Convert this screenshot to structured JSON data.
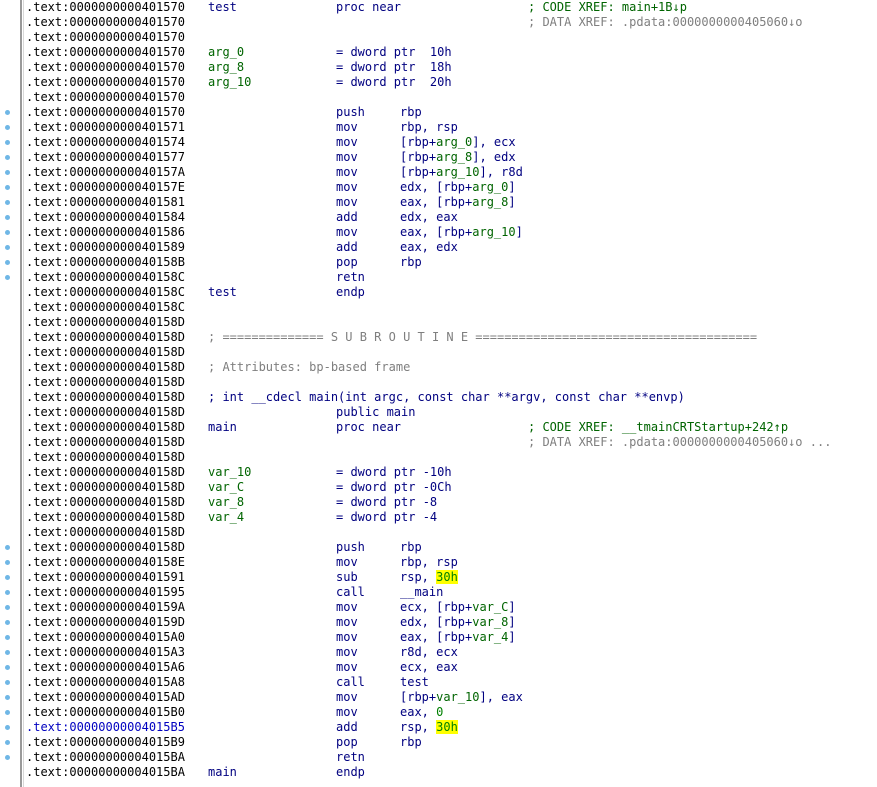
{
  "lines": [
    {
      "addr": ".text:0000000000401570",
      "parts": [
        [
          "label",
          "test",
          "c-blue"
        ],
        [
          "op",
          "proc near",
          "c-blue"
        ],
        [
          "comment",
          "; CODE XREF: main+1B↓p",
          "c-green"
        ]
      ]
    },
    {
      "addr": ".text:0000000000401570",
      "parts": [
        [
          "comment",
          "; DATA XREF: .pdata:0000000000405060↓o",
          "c-gray"
        ]
      ]
    },
    {
      "addr": ".text:0000000000401570",
      "parts": []
    },
    {
      "addr": ".text:0000000000401570",
      "parts": [
        [
          "label",
          "arg_0",
          "c-green"
        ],
        [
          "op",
          "= dword ptr  10h",
          "c-blue"
        ]
      ]
    },
    {
      "addr": ".text:0000000000401570",
      "parts": [
        [
          "label",
          "arg_8",
          "c-green"
        ],
        [
          "op",
          "= dword ptr  18h",
          "c-blue"
        ]
      ]
    },
    {
      "addr": ".text:0000000000401570",
      "parts": [
        [
          "label",
          "arg_10",
          "c-green"
        ],
        [
          "op",
          "= dword ptr  20h",
          "c-blue"
        ]
      ]
    },
    {
      "addr": ".text:0000000000401570",
      "parts": []
    },
    {
      "addr": ".text:0000000000401570",
      "dot": true,
      "parts": [
        [
          "op",
          "push",
          "c-blue"
        ],
        [
          "arg",
          "rbp",
          "c-blue"
        ]
      ]
    },
    {
      "addr": ".text:0000000000401571",
      "dot": true,
      "parts": [
        [
          "op",
          "mov",
          "c-blue"
        ],
        [
          "arg",
          "rbp, rsp",
          "c-blue"
        ]
      ]
    },
    {
      "addr": ".text:0000000000401574",
      "dot": true,
      "parts": [
        [
          "op",
          "mov",
          "c-blue"
        ],
        [
          "argrich",
          [
            [
              "[rbp+",
              "c-blue"
            ],
            [
              "arg_0",
              "c-green"
            ],
            [
              "], ecx",
              "c-blue"
            ]
          ]
        ]
      ]
    },
    {
      "addr": ".text:0000000000401577",
      "dot": true,
      "parts": [
        [
          "op",
          "mov",
          "c-blue"
        ],
        [
          "argrich",
          [
            [
              "[rbp+",
              "c-blue"
            ],
            [
              "arg_8",
              "c-green"
            ],
            [
              "], edx",
              "c-blue"
            ]
          ]
        ]
      ]
    },
    {
      "addr": ".text:000000000040157A",
      "dot": true,
      "parts": [
        [
          "op",
          "mov",
          "c-blue"
        ],
        [
          "argrich",
          [
            [
              "[rbp+",
              "c-blue"
            ],
            [
              "arg_10",
              "c-green"
            ],
            [
              "], r8d",
              "c-blue"
            ]
          ]
        ]
      ]
    },
    {
      "addr": ".text:000000000040157E",
      "dot": true,
      "parts": [
        [
          "op",
          "mov",
          "c-blue"
        ],
        [
          "argrich",
          [
            [
              "edx, [rbp+",
              "c-blue"
            ],
            [
              "arg_0",
              "c-green"
            ],
            [
              "]",
              "c-blue"
            ]
          ]
        ]
      ]
    },
    {
      "addr": ".text:0000000000401581",
      "dot": true,
      "parts": [
        [
          "op",
          "mov",
          "c-blue"
        ],
        [
          "argrich",
          [
            [
              "eax, [rbp+",
              "c-blue"
            ],
            [
              "arg_8",
              "c-green"
            ],
            [
              "]",
              "c-blue"
            ]
          ]
        ]
      ]
    },
    {
      "addr": ".text:0000000000401584",
      "dot": true,
      "parts": [
        [
          "op",
          "add",
          "c-blue"
        ],
        [
          "arg",
          "edx, eax",
          "c-blue"
        ]
      ]
    },
    {
      "addr": ".text:0000000000401586",
      "dot": true,
      "parts": [
        [
          "op",
          "mov",
          "c-blue"
        ],
        [
          "argrich",
          [
            [
              "eax, [rbp+",
              "c-blue"
            ],
            [
              "arg_10",
              "c-green"
            ],
            [
              "]",
              "c-blue"
            ]
          ]
        ]
      ]
    },
    {
      "addr": ".text:0000000000401589",
      "dot": true,
      "parts": [
        [
          "op",
          "add",
          "c-blue"
        ],
        [
          "arg",
          "eax, edx",
          "c-blue"
        ]
      ]
    },
    {
      "addr": ".text:000000000040158B",
      "dot": true,
      "parts": [
        [
          "op",
          "pop",
          "c-blue"
        ],
        [
          "arg",
          "rbp",
          "c-blue"
        ]
      ]
    },
    {
      "addr": ".text:000000000040158C",
      "dot": true,
      "parts": [
        [
          "op",
          "retn",
          "c-blue"
        ]
      ]
    },
    {
      "addr": ".text:000000000040158C",
      "parts": [
        [
          "label",
          "test",
          "c-blue"
        ],
        [
          "op",
          "endp",
          "c-blue"
        ]
      ]
    },
    {
      "addr": ".text:000000000040158C",
      "parts": []
    },
    {
      "addr": ".text:000000000040158D",
      "parts": []
    },
    {
      "addr": ".text:000000000040158D",
      "parts": [
        [
          "full",
          "; ============== S U B R O U T I N E =======================================",
          "c-gray"
        ]
      ]
    },
    {
      "addr": ".text:000000000040158D",
      "parts": []
    },
    {
      "addr": ".text:000000000040158D",
      "parts": [
        [
          "full",
          "; Attributes: bp-based frame",
          "c-gray"
        ]
      ]
    },
    {
      "addr": ".text:000000000040158D",
      "parts": []
    },
    {
      "addr": ".text:000000000040158D",
      "parts": [
        [
          "full",
          "; int __cdecl main(int argc, const char **argv, const char **envp)",
          "c-blue"
        ]
      ]
    },
    {
      "addr": ".text:000000000040158D",
      "parts": [
        [
          "op",
          "public main",
          "c-blue"
        ]
      ]
    },
    {
      "addr": ".text:000000000040158D",
      "parts": [
        [
          "label",
          "main",
          "c-blue"
        ],
        [
          "op",
          "proc near",
          "c-blue"
        ],
        [
          "comment",
          "; CODE XREF: __tmainCRTStartup+242↑p",
          "c-green"
        ]
      ]
    },
    {
      "addr": ".text:000000000040158D",
      "parts": [
        [
          "comment",
          "; DATA XREF: .pdata:0000000000405060↓o ...",
          "c-gray"
        ]
      ]
    },
    {
      "addr": ".text:000000000040158D",
      "parts": []
    },
    {
      "addr": ".text:000000000040158D",
      "parts": [
        [
          "label",
          "var_10",
          "c-green"
        ],
        [
          "op",
          "= dword ptr -10h",
          "c-blue"
        ]
      ]
    },
    {
      "addr": ".text:000000000040158D",
      "parts": [
        [
          "label",
          "var_C",
          "c-green"
        ],
        [
          "op",
          "= dword ptr -0Ch",
          "c-blue"
        ]
      ]
    },
    {
      "addr": ".text:000000000040158D",
      "parts": [
        [
          "label",
          "var_8",
          "c-green"
        ],
        [
          "op",
          "= dword ptr -8",
          "c-blue"
        ]
      ]
    },
    {
      "addr": ".text:000000000040158D",
      "parts": [
        [
          "label",
          "var_4",
          "c-green"
        ],
        [
          "op",
          "= dword ptr -4",
          "c-blue"
        ]
      ]
    },
    {
      "addr": ".text:000000000040158D",
      "parts": []
    },
    {
      "addr": ".text:000000000040158D",
      "dot": true,
      "parts": [
        [
          "op",
          "push",
          "c-blue"
        ],
        [
          "arg",
          "rbp",
          "c-blue"
        ]
      ]
    },
    {
      "addr": ".text:000000000040158E",
      "dot": true,
      "parts": [
        [
          "op",
          "mov",
          "c-blue"
        ],
        [
          "arg",
          "rbp, rsp",
          "c-blue"
        ]
      ]
    },
    {
      "addr": ".text:0000000000401591",
      "dot": true,
      "parts": [
        [
          "op",
          "sub",
          "c-blue"
        ],
        [
          "argrich",
          [
            [
              "rsp, ",
              "c-blue"
            ],
            [
              "30h",
              "hl"
            ]
          ]
        ]
      ]
    },
    {
      "addr": ".text:0000000000401595",
      "dot": true,
      "parts": [
        [
          "op",
          "call",
          "c-blue"
        ],
        [
          "arg",
          "__main",
          "c-blue"
        ]
      ]
    },
    {
      "addr": ".text:000000000040159A",
      "dot": true,
      "parts": [
        [
          "op",
          "mov",
          "c-blue"
        ],
        [
          "argrich",
          [
            [
              "ecx, [rbp+",
              "c-blue"
            ],
            [
              "var_C",
              "c-green"
            ],
            [
              "]",
              "c-blue"
            ]
          ]
        ]
      ]
    },
    {
      "addr": ".text:000000000040159D",
      "dot": true,
      "parts": [
        [
          "op",
          "mov",
          "c-blue"
        ],
        [
          "argrich",
          [
            [
              "edx, [rbp+",
              "c-blue"
            ],
            [
              "var_8",
              "c-green"
            ],
            [
              "]",
              "c-blue"
            ]
          ]
        ]
      ]
    },
    {
      "addr": ".text:00000000004015A0",
      "dot": true,
      "parts": [
        [
          "op",
          "mov",
          "c-blue"
        ],
        [
          "argrich",
          [
            [
              "eax, [rbp+",
              "c-blue"
            ],
            [
              "var_4",
              "c-green"
            ],
            [
              "]",
              "c-blue"
            ]
          ]
        ]
      ]
    },
    {
      "addr": ".text:00000000004015A3",
      "dot": true,
      "parts": [
        [
          "op",
          "mov",
          "c-blue"
        ],
        [
          "arg",
          "r8d, ecx",
          "c-blue"
        ]
      ]
    },
    {
      "addr": ".text:00000000004015A6",
      "dot": true,
      "parts": [
        [
          "op",
          "mov",
          "c-blue"
        ],
        [
          "arg",
          "ecx, eax",
          "c-blue"
        ]
      ]
    },
    {
      "addr": ".text:00000000004015A8",
      "dot": true,
      "parts": [
        [
          "op",
          "call",
          "c-blue"
        ],
        [
          "arg",
          "test",
          "c-blue"
        ]
      ]
    },
    {
      "addr": ".text:00000000004015AD",
      "dot": true,
      "parts": [
        [
          "op",
          "mov",
          "c-blue"
        ],
        [
          "argrich",
          [
            [
              "[rbp+",
              "c-blue"
            ],
            [
              "var_10",
              "c-green"
            ],
            [
              "], eax",
              "c-blue"
            ]
          ]
        ]
      ]
    },
    {
      "addr": ".text:00000000004015B0",
      "dot": true,
      "parts": [
        [
          "op",
          "mov",
          "c-blue"
        ],
        [
          "argrich",
          [
            [
              "eax, ",
              "c-blue"
            ],
            [
              "0",
              "c-num"
            ]
          ]
        ]
      ]
    },
    {
      "addr": ".text:00000000004015B5",
      "dot": true,
      "current": true,
      "parts": [
        [
          "op",
          "add",
          "c-blue"
        ],
        [
          "argrich",
          [
            [
              "rsp, ",
              "c-blue"
            ],
            [
              "30h",
              "hl"
            ]
          ]
        ]
      ]
    },
    {
      "addr": ".text:00000000004015B9",
      "dot": true,
      "parts": [
        [
          "op",
          "pop",
          "c-blue"
        ],
        [
          "arg",
          "rbp",
          "c-blue"
        ]
      ]
    },
    {
      "addr": ".text:00000000004015BA",
      "dot": true,
      "parts": [
        [
          "op",
          "retn",
          "c-blue"
        ]
      ]
    },
    {
      "addr": ".text:00000000004015BA",
      "parts": [
        [
          "label",
          "main",
          "c-blue"
        ],
        [
          "op",
          "endp",
          "c-blue"
        ]
      ]
    }
  ]
}
